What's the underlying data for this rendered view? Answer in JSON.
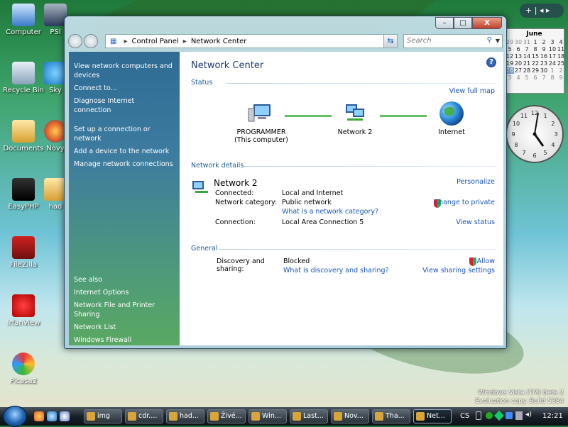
{
  "desktop": {
    "icons": [
      {
        "label": "Computer"
      },
      {
        "label": "PSI"
      },
      {
        "label": "Recycle Bin"
      },
      {
        "label": "Sky"
      },
      {
        "label": "Documents"
      },
      {
        "label": "Novy"
      },
      {
        "label": "EasyPHP"
      },
      {
        "label": "had"
      },
      {
        "label": "FileZilla"
      },
      {
        "label": "IrfanView"
      },
      {
        "label": "Picasa2"
      }
    ],
    "watermark_line1": "Windows Vista (TM) Beta 2",
    "watermark_line2": "Evaluation copy. Build 5384"
  },
  "window": {
    "address": {
      "root": "Control Panel",
      "current": "Network Center"
    },
    "search_placeholder": "Search",
    "minimize": "–",
    "maximize": "□",
    "close": "X"
  },
  "left_pane": {
    "tasks": [
      "View network computers and devices",
      "Connect to...",
      "Diagnose Internet connection",
      "Set up a connection or network",
      "Add a device to the network",
      "Manage network connections"
    ],
    "see_also_heading": "See also",
    "see_also": [
      "Internet Options",
      "Network File and Printer Sharing",
      "Network List",
      "Windows Firewall"
    ]
  },
  "main": {
    "title": "Network Center",
    "help": "?",
    "status": {
      "heading": "Status",
      "view_full_map": "View full map",
      "nodes": [
        {
          "label": "PROGRAMMER",
          "sub": "(This computer)"
        },
        {
          "label": "Network 2",
          "sub": ""
        },
        {
          "label": "Internet",
          "sub": ""
        }
      ]
    },
    "details": {
      "heading": "Network details",
      "network_name": "Network 2",
      "personalize": "Personalize",
      "rows": [
        {
          "label": "Connected:",
          "value": "Local and Internet"
        },
        {
          "label": "Network category:",
          "value": "Public network"
        },
        {
          "label": "Connection:",
          "value": "Local Area Connection 5"
        }
      ],
      "category_help": "What is a network category?",
      "change_to_private": "Change to private",
      "view_status": "View status"
    },
    "general": {
      "heading": "General",
      "label_line1": "Discovery and",
      "label_line2": "sharing:",
      "value": "Blocked",
      "help_link": "What is discovery and sharing?",
      "allow": "Allow",
      "view_sharing": "View sharing settings"
    }
  },
  "calendar": {
    "month": "June",
    "days": [
      "29",
      "30",
      "31",
      "1",
      "2",
      "3",
      "4",
      "5",
      "6",
      "7",
      "8",
      "9",
      "10",
      "11",
      "12",
      "13",
      "14",
      "15",
      "16",
      "17",
      "18",
      "19",
      "20",
      "21",
      "22",
      "23",
      "24",
      "25",
      "26",
      "27",
      "28",
      "29",
      "30",
      "1",
      "2",
      "3",
      "4",
      "5",
      "6",
      "7",
      "8",
      "9"
    ],
    "today": "26",
    "clock_hours": [
      "12",
      "1",
      "2",
      "3",
      "4",
      "5",
      "6",
      "7",
      "8",
      "9",
      "10",
      "11"
    ]
  },
  "taskbar": {
    "tasks": [
      "img",
      "cdr....",
      "had...",
      "Živé...",
      "Win...",
      "Last...",
      "Nov...",
      "Tha...",
      "Net..."
    ],
    "language": "CS",
    "time": "12:21"
  },
  "gadget_controls": "+ | ◂ ▸"
}
